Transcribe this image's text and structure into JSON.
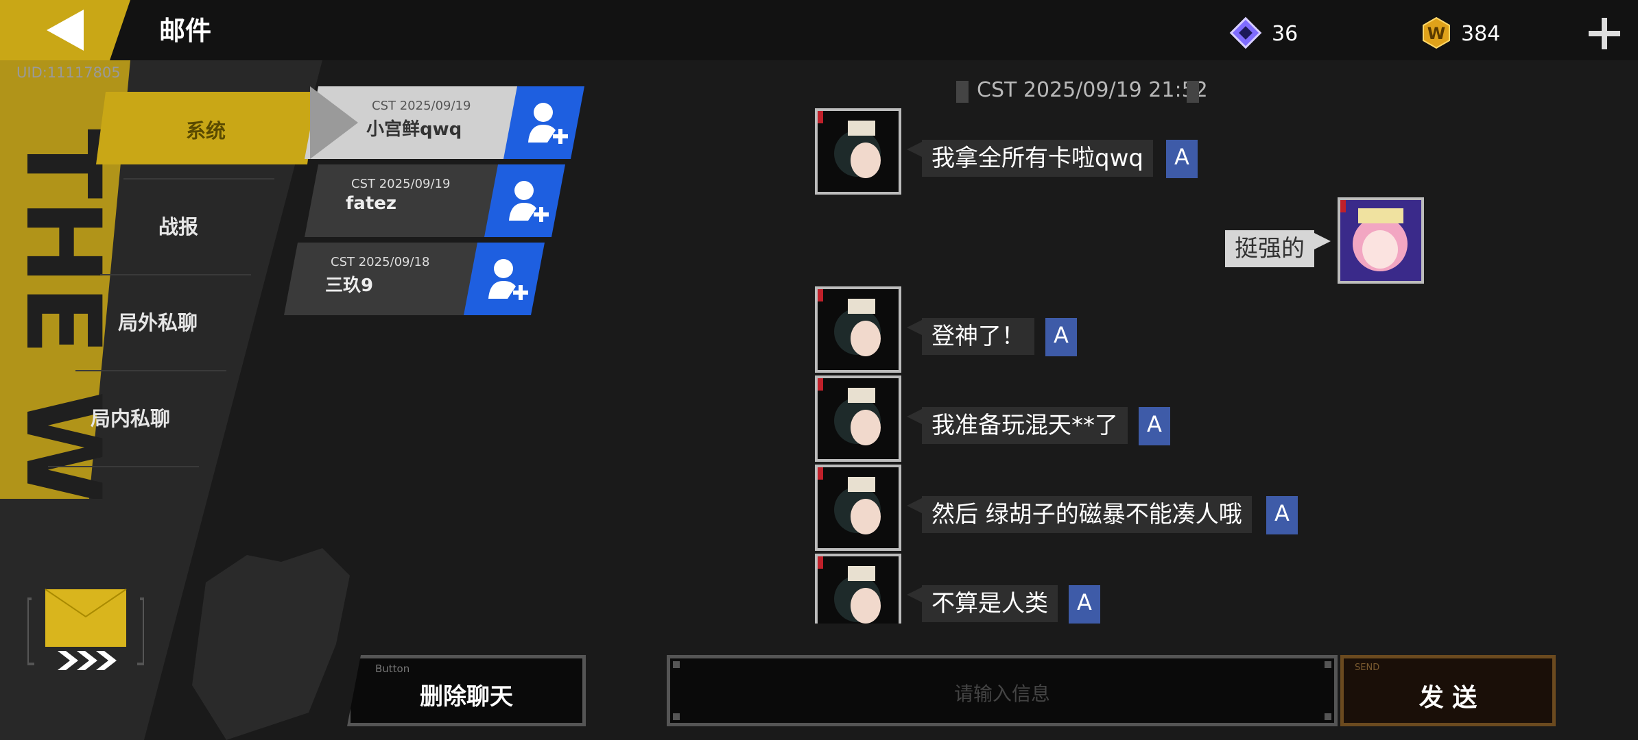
{
  "header": {
    "title": "邮件",
    "uid": "UID:11117805",
    "currencies": [
      {
        "icon": "crystal-icon",
        "value": "36",
        "color": "#7f6cff"
      },
      {
        "icon": "w-coin-icon",
        "value": "384",
        "color": "#e0a21a"
      }
    ]
  },
  "sidebar": {
    "tabs": [
      {
        "label": "系统",
        "active": true
      },
      {
        "label": "战报",
        "active": false
      },
      {
        "label": "局外私聊",
        "active": false
      },
      {
        "label": "局内私聊",
        "active": false
      }
    ]
  },
  "contacts": [
    {
      "date": "CST 2025/09/19",
      "name": "小宫鲜qwq",
      "selected": true
    },
    {
      "date": "CST 2025/09/19",
      "name": "fatez",
      "selected": false
    },
    {
      "date": "CST 2025/09/18",
      "name": "三玖9",
      "selected": false
    }
  ],
  "chat": {
    "timestamp": "CST 2025/09/19 21:52",
    "messages": [
      {
        "side": "left",
        "text": "我拿全所有卡啦qwq"
      },
      {
        "side": "right",
        "text": "挺强的"
      },
      {
        "side": "left",
        "text": "登神了！"
      },
      {
        "side": "left",
        "text": "我准备玩混天**了"
      },
      {
        "side": "left",
        "text": "然后 绿胡子的磁暴不能凑人哦"
      },
      {
        "side": "left",
        "text": "不算是人类"
      }
    ],
    "translate_symbol": "A"
  },
  "footer": {
    "delete_button_small": "Button",
    "delete_button": "删除聊天",
    "input_placeholder": "请输入信息",
    "send_small": "SEND",
    "send_button": "发 送"
  },
  "colors": {
    "accent_gold": "#c9a716",
    "add_blue": "#1e5fe0",
    "translate_blue": "#3e5ba8"
  }
}
